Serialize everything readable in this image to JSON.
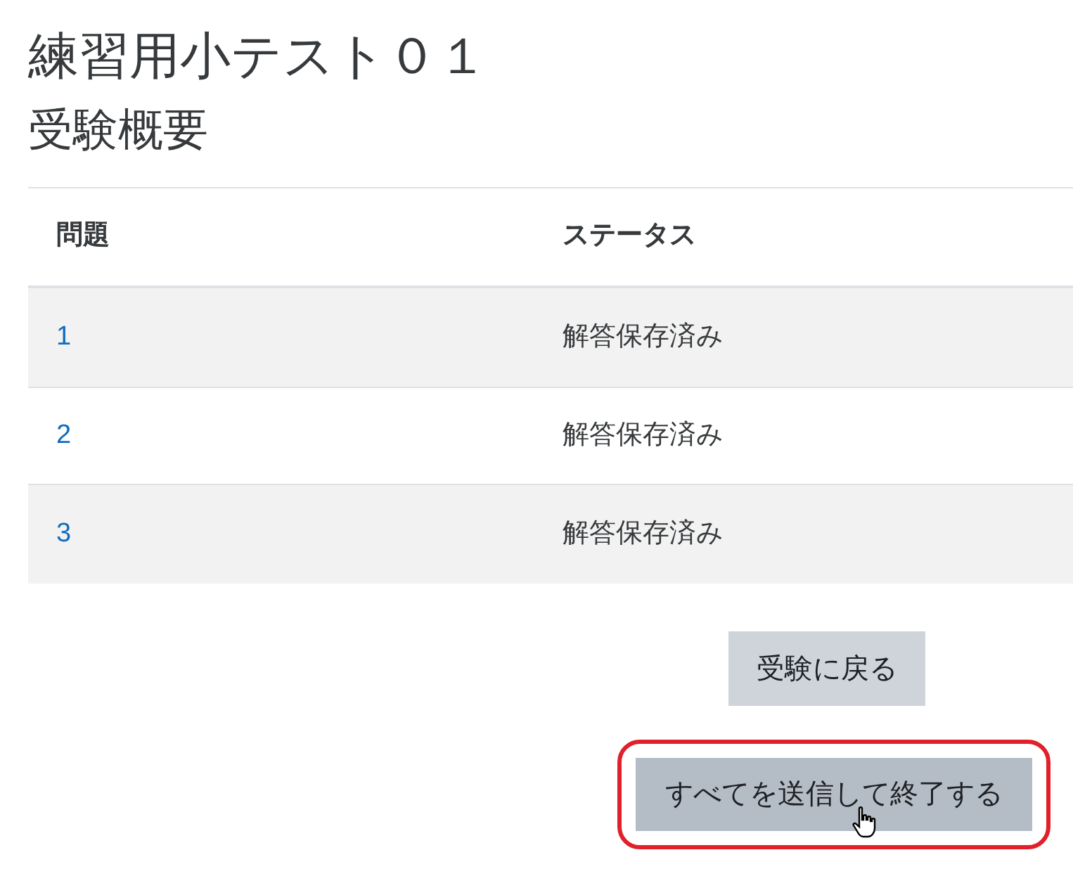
{
  "title": "練習用小テスト０１",
  "subtitle": "受験概要",
  "table": {
    "columns": [
      "問題",
      "ステータス"
    ],
    "rows": [
      {
        "question": "1",
        "status": "解答保存済み"
      },
      {
        "question": "2",
        "status": "解答保存済み"
      },
      {
        "question": "3",
        "status": "解答保存済み"
      }
    ]
  },
  "buttons": [
    {
      "label": "受験に戻る",
      "highlighted": false
    },
    {
      "label": "すべてを送信して終了する",
      "highlighted": true
    }
  ]
}
